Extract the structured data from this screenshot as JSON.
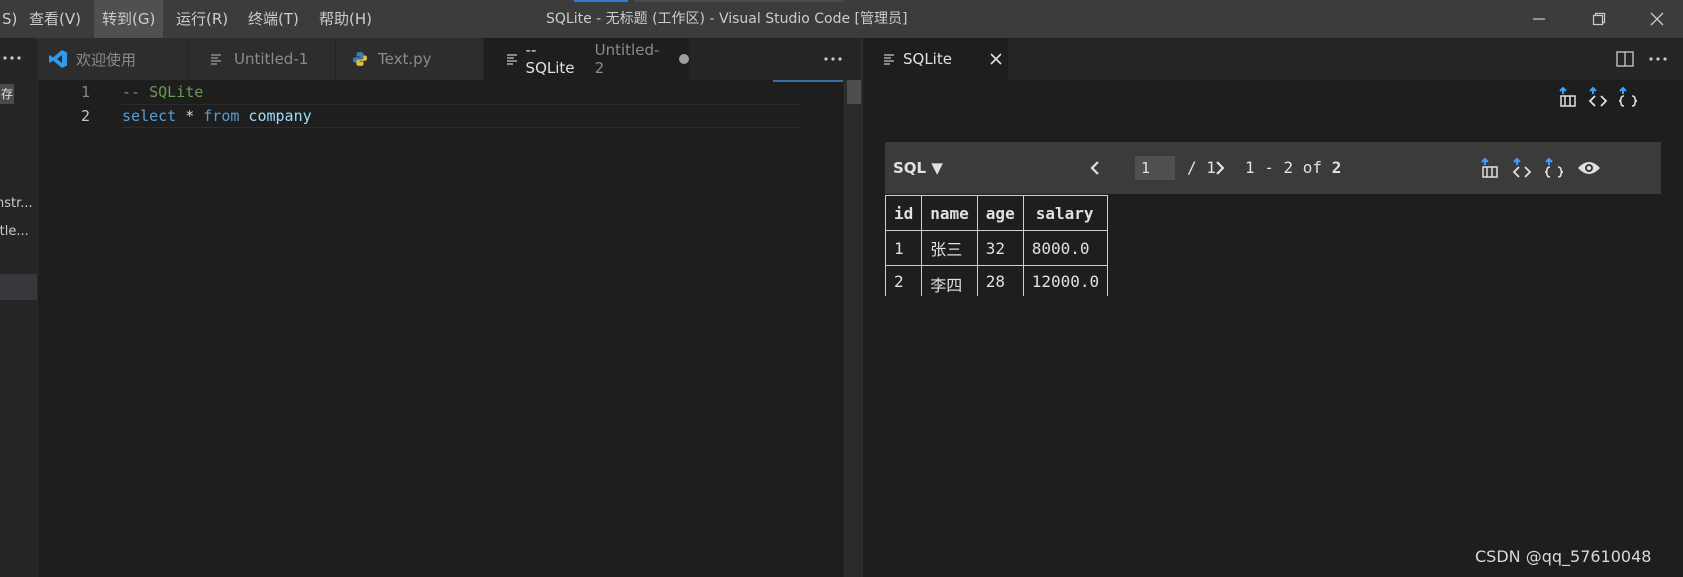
{
  "menu": {
    "items": [
      {
        "label": "S)"
      },
      {
        "label": "查看(V)"
      },
      {
        "label": "转到(G)"
      },
      {
        "label": "运行(R)"
      },
      {
        "label": "终端(T)"
      },
      {
        "label": "帮助(H)"
      }
    ],
    "window_title": "SQLite - 无标题 (工作区) - Visual Studio Code [管理员]"
  },
  "sidebar": {
    "badge": "存",
    "items": [
      "nstr...",
      "itle..."
    ]
  },
  "tabs": [
    {
      "label": "欢迎使用",
      "icon": "vscode-icon"
    },
    {
      "label": "Untitled-1",
      "icon": "file-lines-icon"
    },
    {
      "label": "Text.py",
      "icon": "python-icon"
    },
    {
      "label": "-- SQLite",
      "detail": "Untitled-2",
      "icon": "file-lines-icon",
      "active": true,
      "dirty": true
    }
  ],
  "editor": {
    "lines": [
      {
        "number": "1",
        "text": "-- SQLite"
      },
      {
        "number": "2",
        "keyword1": "select",
        "star": " * ",
        "keyword2": "from",
        "table": " company"
      }
    ]
  },
  "panel": {
    "tab_label": "SQLite",
    "toolbar": {
      "mode": "SQL ▼",
      "page": "1",
      "page_total": "/ 1",
      "range": "1 - 2 of ",
      "total": "2"
    },
    "table": {
      "headers": [
        "id",
        "name",
        "age",
        "salary"
      ],
      "rows": [
        [
          "1",
          "张三",
          "32",
          "8000.0"
        ],
        [
          "2",
          "李四",
          "28",
          "12000.0"
        ]
      ]
    }
  },
  "watermark": "CSDN @qq_57610048",
  "colors": {
    "accent": "#2f7bd8",
    "keyword": "#569cd6",
    "comment": "#6a9955",
    "identifier": "#9cdcfe"
  }
}
